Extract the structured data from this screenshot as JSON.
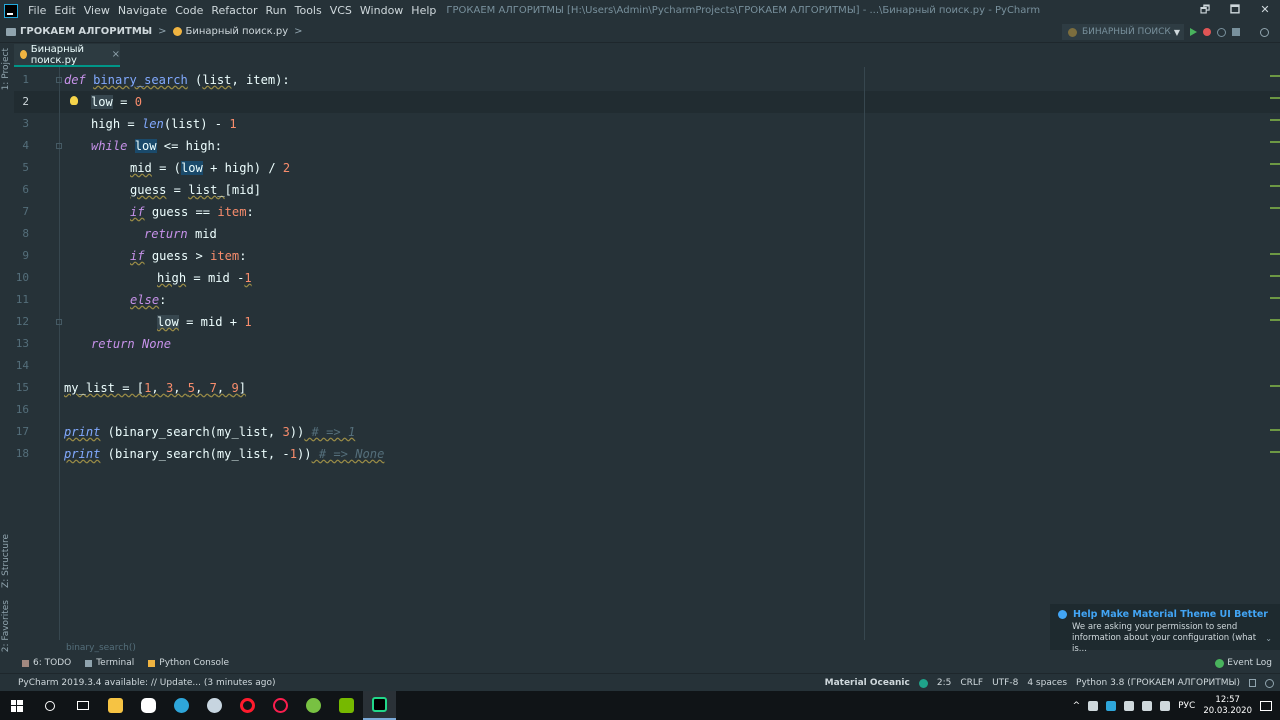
{
  "menu": {
    "items": [
      "File",
      "Edit",
      "View",
      "Navigate",
      "Code",
      "Refactor",
      "Run",
      "Tools",
      "VCS",
      "Window",
      "Help"
    ],
    "window_title": "ГРОКАЕМ АЛГОРИТМЫ [H:\\Users\\Admin\\PycharmProjects\\ГРОКАЕМ АЛГОРИТМЫ] - ...\\Бинарный поиск.py - PyCharm",
    "controls": [
      "🗗",
      "🗖",
      "✕"
    ]
  },
  "navbar": {
    "project": "ГРОКАЕМ АЛГОРИТМЫ",
    "file": "Бинарный поиск.py",
    "run_config": "БИНАРНЫЙ ПОИСК"
  },
  "left_strip": {
    "project": "1: Project",
    "structure": "Z: Structure",
    "favorites": "2: Favorites"
  },
  "tabs": [
    {
      "label": "Бинарный поиск.py",
      "close": "×"
    }
  ],
  "editor": {
    "line_numbers": [
      "1",
      "2",
      "3",
      "4",
      "5",
      "6",
      "7",
      "8",
      "9",
      "10",
      "11",
      "12",
      "13",
      "14",
      "15",
      "16",
      "17",
      "18"
    ],
    "code": {
      "l1": [
        "def",
        "binary_search",
        " (",
        "list",
        ", ",
        "item",
        "):"
      ],
      "l2": [
        "low",
        " = ",
        "0"
      ],
      "l3": [
        "high = ",
        "len",
        "(list) - ",
        "1"
      ],
      "l4": [
        "while",
        " ",
        "low",
        " <= high:"
      ],
      "l5": [
        "mid",
        " = (",
        "low",
        " + high) / ",
        "2"
      ],
      "l6": [
        "guess",
        " = ",
        "list_",
        "[mid]"
      ],
      "l7": [
        "if",
        " guess == ",
        "item",
        ":"
      ],
      "l8": [
        "return",
        " mid"
      ],
      "l9": [
        "if",
        " guess > ",
        "item",
        ":"
      ],
      "l10": [
        "high",
        " = mid -",
        "1"
      ],
      "l11": [
        "else",
        ":"
      ],
      "l12": [
        "low",
        " = mid + ",
        "1"
      ],
      "l13": [
        "return",
        " ",
        "None"
      ],
      "l15": [
        "my_list = [",
        "1",
        ", ",
        "3",
        ", ",
        "5",
        ", ",
        "7",
        ", ",
        "9",
        "]"
      ],
      "l17": [
        "print",
        " (binary_search(my_list, ",
        "3",
        "))",
        " # => 1"
      ],
      "l18": [
        "print",
        " (binary_search(my_list, -",
        "1",
        "))",
        " # => None"
      ]
    },
    "breadcrumb": "binary_search()"
  },
  "tool_tabs": {
    "todo": "6: TODO",
    "terminal": "Terminal",
    "python_console": "Python Console",
    "event_log": "Event Log"
  },
  "status": {
    "update": "PyCharm 2019.3.4 available: // Update... (3 minutes ago)",
    "theme": "Material Oceanic",
    "position": "2:5",
    "line_sep": "CRLF",
    "encoding": "UTF-8",
    "indent": "4 spaces",
    "interpreter": "Python 3.8 (ГРОКАЕМ АЛГОРИТМЫ)"
  },
  "notification": {
    "title": "Help Make Material Theme UI Better",
    "body_1": "We are asking your permission to send",
    "body_2": "information about your configuration (what is..."
  },
  "taskbar": {
    "lang": "РУС",
    "time": "12:57",
    "date": "20.03.2020"
  },
  "colors": {
    "background": "#263238",
    "keyword": "#c792ea",
    "function": "#82aaff",
    "number": "#f78c6c",
    "comment": "#546e7a",
    "accent": "#009688"
  }
}
